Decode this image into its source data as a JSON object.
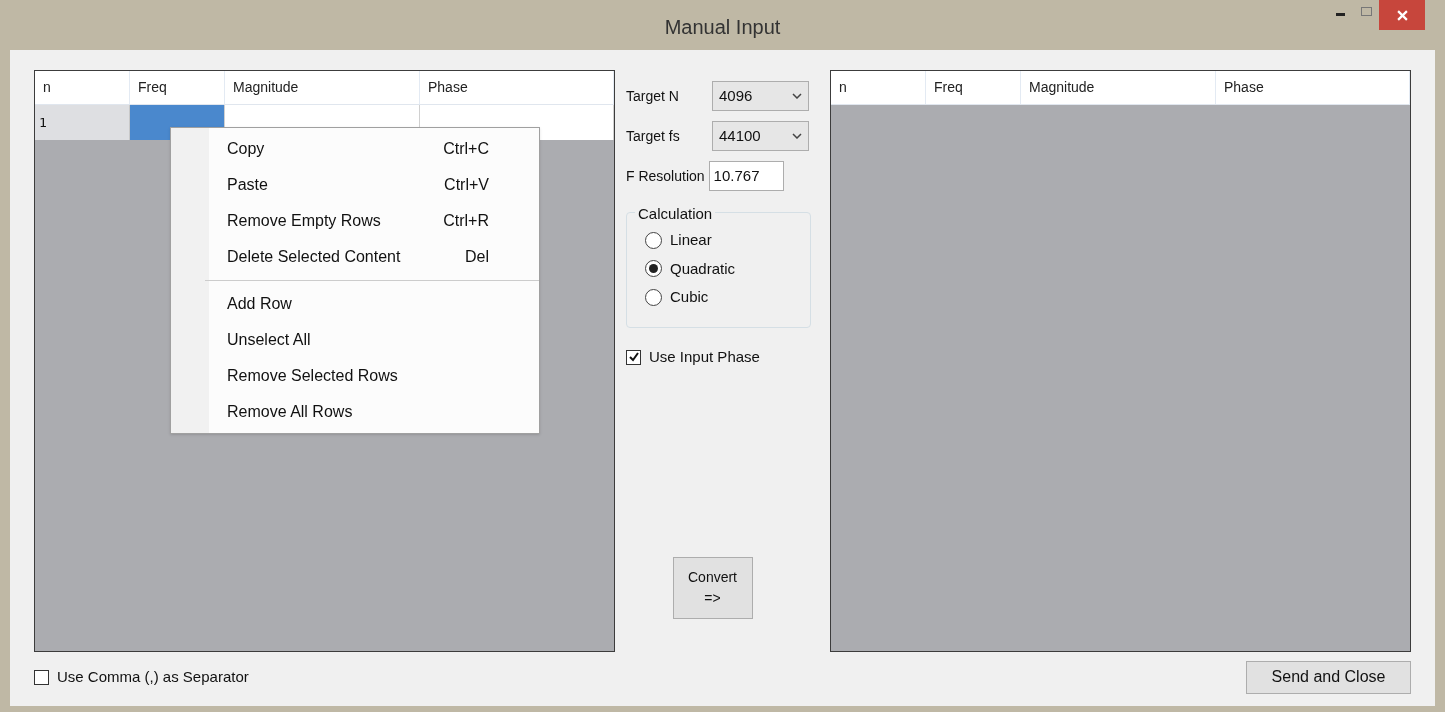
{
  "window": {
    "title": "Manual Input"
  },
  "input_table": {
    "columns": [
      "n",
      "Freq",
      "Magnitude",
      "Phase"
    ],
    "rows": [
      {
        "n": "1",
        "cells": [
          {
            "selected": true
          },
          {
            "selected": false
          },
          {
            "selected": false
          }
        ]
      }
    ]
  },
  "context_menu": {
    "groups": [
      [
        {
          "label": "Copy",
          "shortcut": "Ctrl+C"
        },
        {
          "label": "Paste",
          "shortcut": "Ctrl+V"
        },
        {
          "label": "Remove Empty Rows",
          "shortcut": "Ctrl+R"
        },
        {
          "label": "Delete Selected Content",
          "shortcut": "Del"
        }
      ],
      [
        {
          "label": "Add Row"
        },
        {
          "label": "Unselect All"
        },
        {
          "label": "Remove Selected Rows"
        },
        {
          "label": "Remove All Rows"
        }
      ]
    ]
  },
  "settings": {
    "target_n": {
      "label": "Target N",
      "value": "4096"
    },
    "target_fs": {
      "label": "Target fs",
      "value": "44100"
    },
    "f_resolution": {
      "label": "F Resolution",
      "value": "10.767"
    }
  },
  "calculation": {
    "title": "Calculation",
    "options": [
      {
        "label": "Linear",
        "selected": false
      },
      {
        "label": "Quadratic",
        "selected": true
      },
      {
        "label": "Cubic",
        "selected": false
      }
    ]
  },
  "use_input_phase": {
    "label": "Use Input Phase",
    "checked": true
  },
  "convert_button": {
    "lines": [
      "Convert",
      "=>"
    ]
  },
  "output_table": {
    "columns": [
      "n",
      "Freq",
      "Magnitude",
      "Phase"
    ]
  },
  "use_comma": {
    "label": "Use Comma (,) as Separator",
    "checked": false
  },
  "send_button": "Send and Close"
}
